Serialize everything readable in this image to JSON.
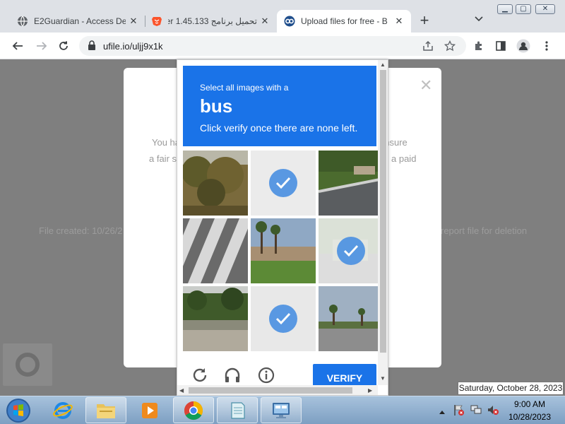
{
  "browser": {
    "tabs": [
      {
        "title": "E2Guardian - Access De",
        "favicon": "globe-icon"
      },
      {
        "title": "تحميل برنامج ser 1.45.133",
        "favicon": "brave-lion-icon"
      },
      {
        "title": "Upload files for free - B",
        "favicon": "ufile-logo-icon"
      }
    ],
    "url": "ufile.io/uljj9x1k"
  },
  "page": {
    "line1_left": "You ha",
    "line1_right": "ensure",
    "line2_left": "a fair s",
    "line2_right": "a paid",
    "bg_left": "File created: 10/26/2",
    "bg_right": "report file for deletion"
  },
  "captcha": {
    "instruction": "Select all images with a",
    "object": "bus",
    "subtext": "Click verify once there are none left.",
    "verify_label": "VERIFY",
    "tiles": [
      {
        "id": "t1",
        "content": "tree-bushes",
        "selected": false
      },
      {
        "id": "t2",
        "content": "faded-tile",
        "selected": true
      },
      {
        "id": "t3",
        "content": "street-corner",
        "selected": false
      },
      {
        "id": "t4",
        "content": "crosswalk",
        "selected": false
      },
      {
        "id": "t5",
        "content": "palm-trees",
        "selected": false
      },
      {
        "id": "t6",
        "content": "bus-road",
        "selected": true
      },
      {
        "id": "t7",
        "content": "trees-road",
        "selected": false
      },
      {
        "id": "t8",
        "content": "faded-tile",
        "selected": true
      },
      {
        "id": "t9",
        "content": "palm-road",
        "selected": false
      }
    ]
  },
  "tooltip": {
    "date": "Saturday, October 28, 2023"
  },
  "taskbar": {
    "clock_time": "9:00 AM",
    "clock_date": "10/28/2023"
  },
  "colors": {
    "captcha_blue": "#1a73e8",
    "overlay_gray": "#7f7f7f",
    "check_blue": "#4a90e2"
  }
}
